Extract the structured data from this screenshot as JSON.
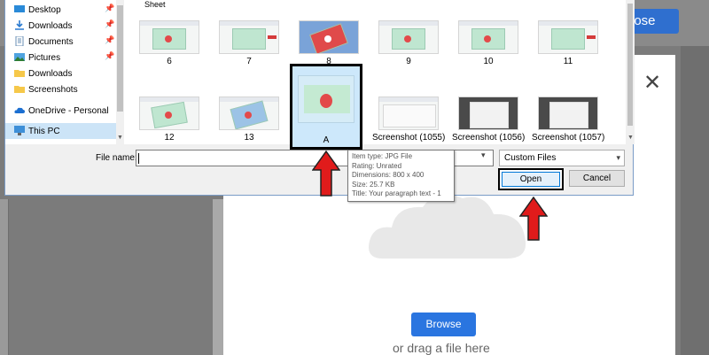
{
  "background": {
    "close_label": "lose"
  },
  "upload_panel": {
    "close_glyph": "✕",
    "browse_label": "Browse",
    "drag_text": "or drag a file here"
  },
  "dialog": {
    "folder_header_line1": "",
    "folder_header_line2": "Sheet",
    "nav_items": [
      {
        "label": "Desktop",
        "icon": "desktop-icon",
        "pinned": true
      },
      {
        "label": "Downloads",
        "icon": "download-icon",
        "pinned": true
      },
      {
        "label": "Documents",
        "icon": "document-icon",
        "pinned": true
      },
      {
        "label": "Pictures",
        "icon": "pictures-icon",
        "pinned": true
      },
      {
        "label": "Downloads",
        "icon": "folder-icon",
        "pinned": false
      },
      {
        "label": "Screenshots",
        "icon": "folder-icon",
        "pinned": false
      },
      {
        "label": "OneDrive - Personal",
        "icon": "cloud-icon",
        "pinned": false
      },
      {
        "label": "This PC",
        "icon": "computer-icon",
        "pinned": false
      }
    ],
    "files_row1": [
      "6",
      "7",
      "8",
      "9",
      "10",
      "11"
    ],
    "files_row2": [
      "12",
      "13",
      "A",
      "Screenshot (1055)",
      "Screenshot (1056)",
      "Screenshot (1057)"
    ],
    "selected_file": "A",
    "filename_label": "File name:",
    "filename_value": "",
    "filetype_value": "Custom Files",
    "open_label": "Open",
    "cancel_label": "Cancel"
  },
  "tooltip": {
    "type": "Item type: JPG File",
    "rating": "Rating: Unrated",
    "dimensions": "Dimensions: 800 x 400",
    "size": "Size: 25.7 KB",
    "title": "Title: Your paragraph text - 1"
  },
  "colors": {
    "accent_blue": "#2a75e0",
    "annotation_red": "#e01b1b",
    "selection_blue": "#cce4f7"
  }
}
